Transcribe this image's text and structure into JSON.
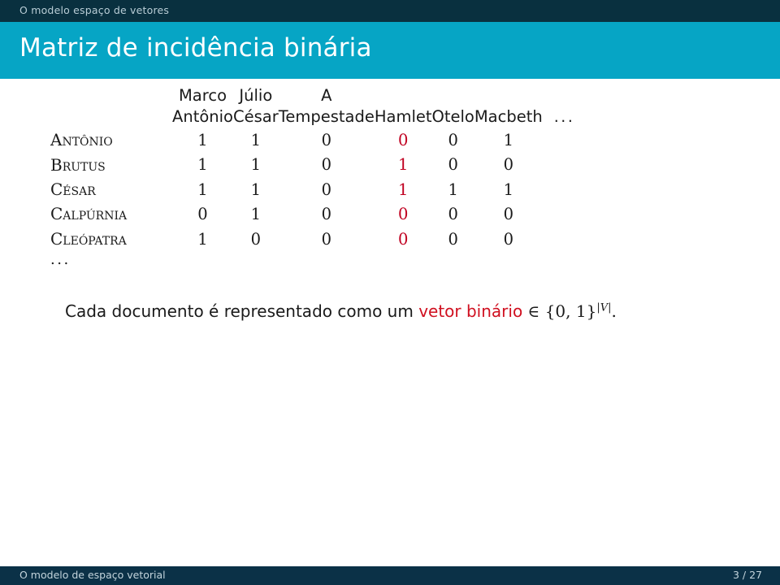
{
  "header": {
    "breadcrumb": "O modelo espaço de vetores",
    "title": "Matriz de incidência binária",
    "bar_color": "#09303f",
    "title_bar_color": "#06a5c5"
  },
  "matrix": {
    "corner_label": "",
    "column_headers": [
      {
        "line1": "Marco",
        "line2": "Antônio"
      },
      {
        "line1": "Júlio",
        "line2": "César"
      },
      {
        "line1": "A",
        "line2": "Tempestade"
      },
      {
        "line1": "Hamlet",
        "line2": ""
      },
      {
        "line1": "Otelo",
        "line2": ""
      },
      {
        "line1": "Macbeth",
        "line2": ""
      },
      {
        "line1": "...",
        "line2": ""
      }
    ],
    "rows": [
      {
        "label": "Antônio",
        "values": [
          "1",
          "1",
          "0",
          "0",
          "0",
          "1"
        ]
      },
      {
        "label": "Brutus",
        "values": [
          "1",
          "1",
          "0",
          "1",
          "0",
          "0"
        ]
      },
      {
        "label": "César",
        "values": [
          "1",
          "1",
          "0",
          "1",
          "1",
          "1"
        ]
      },
      {
        "label": "Calpúrnia",
        "values": [
          "0",
          "1",
          "0",
          "0",
          "0",
          "0"
        ]
      },
      {
        "label": "Cleópatra",
        "values": [
          "1",
          "0",
          "0",
          "0",
          "0",
          "0"
        ]
      }
    ],
    "row_ellipsis": "...",
    "highlight_column_index": 3,
    "highlight_color": "#c00020",
    "text_color": "#1a1a1a"
  },
  "caption": {
    "part1": "Cada documento é representado como um ",
    "accent": "vetor binário",
    "part2": " ∈ {0, 1}",
    "exponent_open": "|",
    "exponent_var": "V",
    "exponent_close": "|",
    "part3": ".",
    "accent_color": "#d01020"
  },
  "footer": {
    "left": "O modelo de espaço vetorial",
    "right": "3 / 27",
    "bar_color": "#0b3147"
  }
}
